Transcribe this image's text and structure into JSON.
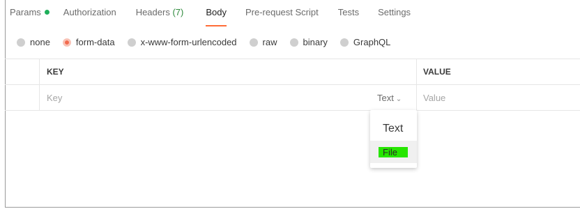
{
  "tabs": [
    {
      "label": "Params",
      "active": false,
      "has_dot": true
    },
    {
      "label": "Authorization",
      "active": false
    },
    {
      "label": "Headers",
      "count": " (7)",
      "active": false
    },
    {
      "label": "Body",
      "active": true
    },
    {
      "label": "Pre-request Script",
      "active": false
    },
    {
      "label": "Tests",
      "active": false
    },
    {
      "label": "Settings",
      "active": false
    }
  ],
  "body_modes": [
    {
      "label": "none",
      "selected": false
    },
    {
      "label": "form-data",
      "selected": true
    },
    {
      "label": "x-www-form-urlencoded",
      "selected": false
    },
    {
      "label": "raw",
      "selected": false
    },
    {
      "label": "binary",
      "selected": false
    },
    {
      "label": "GraphQL",
      "selected": false
    }
  ],
  "table": {
    "headers": {
      "key": "KEY",
      "value": "VALUE"
    },
    "row": {
      "key_placeholder": "Key",
      "type_label": "Text",
      "value_placeholder": "Value"
    }
  },
  "type_dropdown": {
    "options": [
      "Text",
      "File"
    ],
    "highlighted": "File"
  },
  "colors": {
    "accent": "#ff6c37",
    "params_dot": "#1faf5a",
    "headers_count": "#2f8a3d",
    "file_highlight": "#26e600"
  }
}
